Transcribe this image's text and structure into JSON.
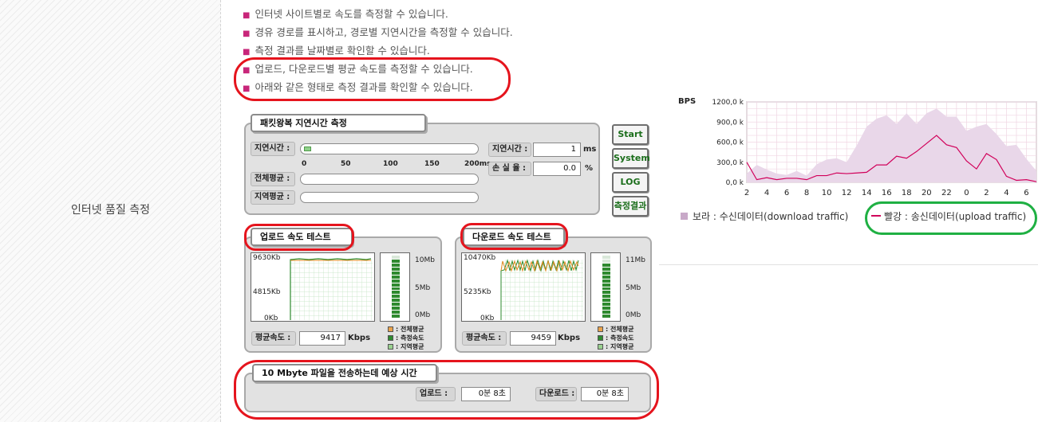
{
  "sidebar": {
    "label": "인터넷 품질 측정"
  },
  "bullets": [
    "인터넷 사이트별로 속도를 측정할 수 있습니다.",
    "경유 경로를 표시하고, 경로별 지연시간을 측정할 수 있습니다.",
    "측정 결과를 날짜별로 확인할 수 있습니다.",
    "업로드, 다운로드별 평균 속도를 측정할 수 있습니다.",
    "아래와 같은 형태로 측정 결과를 확인할 수 있습니다."
  ],
  "latency_panel": {
    "title": "패킷왕복 지연시간 측정",
    "row_labels": [
      "지연시간 :",
      "전체평균 :",
      "지역평균 :"
    ],
    "scale": [
      "0",
      "50",
      "100",
      "150",
      "200ms"
    ],
    "latency_fill": 0.04,
    "latency_label": "지연시간 :",
    "latency_value": "1",
    "latency_unit": "ms",
    "loss_label": "손 실 율 :",
    "loss_value": "0.0",
    "loss_unit": "%"
  },
  "side_buttons": [
    "Start",
    "System",
    "LOG",
    "측정결과"
  ],
  "upload_panel": {
    "title": "업로드 속도 테스트",
    "y_labels": [
      "9630Kb",
      "4815Kb",
      "0Kb"
    ],
    "meter_labels": [
      "10Mb",
      "5Mb",
      "0Mb"
    ],
    "meter_fill": 0.95,
    "avg_label": "평균속도 :",
    "avg_value": "9417",
    "avg_unit": "Kbps",
    "legend": [
      "전체평균",
      "측정속도",
      "지역평균"
    ]
  },
  "download_panel": {
    "title": "다운로드 속도 테스트",
    "y_labels": [
      "10470Kb",
      "5235Kb",
      "0Kb"
    ],
    "meter_labels": [
      "11Mb",
      "5Mb",
      "0Mb"
    ],
    "meter_fill": 0.86,
    "avg_label": "평균속도 :",
    "avg_value": "9459",
    "avg_unit": "Kbps",
    "legend": [
      "전체평균",
      "측정속도",
      "지역평균"
    ]
  },
  "transfer_panel": {
    "title": "10 Mbyte 파일을 전송하는데 예상 시간",
    "upload_label": "업로드 :",
    "upload_value": "0분 8초",
    "download_label": "다운로드 :",
    "download_value": "0분 8초"
  },
  "traffic_chart": {
    "unit_label": "BPS",
    "legend_download": "보라 : 수신데이터(download traffic)",
    "legend_upload": "빨강 : 송신데이터(upload traffic)"
  },
  "colors": {
    "highlight_red": "#e5141d",
    "highlight_green": "#1fb043",
    "download_fill": "#e9d7e9",
    "upload_line": "#d1005a",
    "meter_green": "#2f8a2f"
  },
  "chart_data": {
    "type": "area",
    "x": [
      "2",
      "3",
      "4",
      "5",
      "6",
      "7",
      "8",
      "9",
      "10",
      "11",
      "12",
      "13",
      "14",
      "15",
      "16",
      "17",
      "18",
      "19",
      "20",
      "21",
      "22",
      "23",
      "0",
      "1",
      "2",
      "3",
      "4",
      "5",
      "6",
      "7"
    ],
    "x_tick_labels": [
      "2",
      "4",
      "6",
      "8",
      "10",
      "12",
      "14",
      "16",
      "18",
      "20",
      "22",
      "0",
      "2",
      "4",
      "6"
    ],
    "ylim": [
      0,
      1200
    ],
    "y_tick_labels": [
      "1200,0 k",
      "900,0 k",
      "600,0 k",
      "300,0 k",
      "0,0 k"
    ],
    "ylabel": "BPS",
    "grid": true,
    "series": [
      {
        "name": "수신데이터(download traffic)",
        "values": [
          130,
          260,
          190,
          130,
          110,
          170,
          100,
          270,
          340,
          360,
          300,
          550,
          830,
          950,
          1000,
          870,
          1030,
          870,
          1030,
          1100,
          980,
          980,
          770,
          830,
          870,
          720,
          540,
          560,
          350,
          170
        ]
      },
      {
        "name": "송신데이터(upload traffic)",
        "values": [
          300,
          40,
          70,
          40,
          60,
          60,
          40,
          100,
          100,
          140,
          130,
          140,
          150,
          260,
          260,
          390,
          360,
          460,
          580,
          700,
          560,
          520,
          320,
          200,
          430,
          340,
          90,
          30,
          40,
          10
        ]
      }
    ]
  }
}
